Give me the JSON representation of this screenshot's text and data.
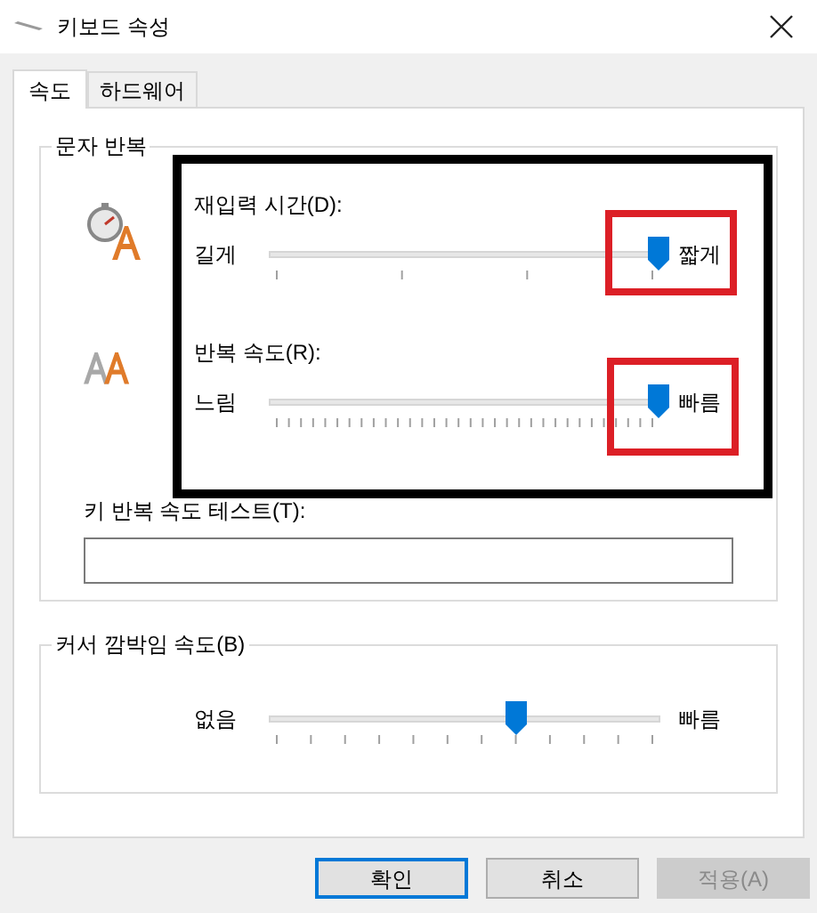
{
  "window": {
    "title": "키보드 속성"
  },
  "tabs": [
    {
      "label": "속도",
      "selected": true
    },
    {
      "label": "하드웨어",
      "selected": false
    }
  ],
  "character_repeat": {
    "title": "문자 반복",
    "sliders": [
      {
        "kind": "delay",
        "label": "재입력 시간(D):",
        "min_label": "길게",
        "max_label": "짧게",
        "level": 1
      },
      {
        "kind": "rate",
        "label": "반복 속도(R):",
        "min_label": "느림",
        "max_label": "빠름",
        "level": 1
      }
    ],
    "test_label": "키 반복 속도 테스트(T):"
  },
  "cursor_blink": {
    "title": "커서 깜박임 속도(B)",
    "min_label": "없음",
    "max_label": "빠름",
    "level": 0.635
  },
  "buttons": [
    {
      "label": "확인",
      "kind": "default",
      "disabled": false
    },
    {
      "label": "취소",
      "kind": "normal",
      "disabled": false
    },
    {
      "label": "적용(A)",
      "kind": "normal",
      "disabled": true
    }
  ]
}
